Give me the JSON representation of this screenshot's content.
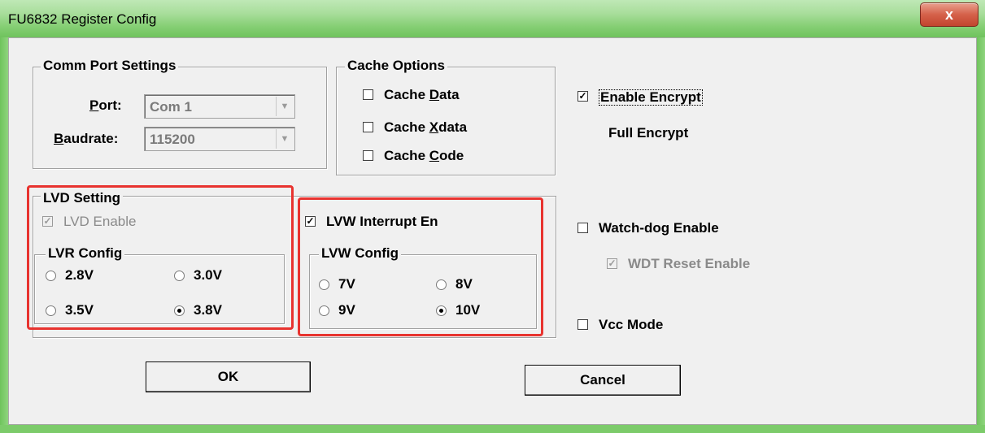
{
  "window": {
    "title": "FU6832 Register Config",
    "close_glyph": "x"
  },
  "comm_port": {
    "title": "Comm Port Settings",
    "port_label": "Port:",
    "port_value": "Com 1",
    "baud_label": "Baudrate:",
    "baud_value": "115200"
  },
  "cache": {
    "title": "Cache Options",
    "items": [
      {
        "label": "Cache Data",
        "checked": false
      },
      {
        "label": "Cache Xdata",
        "checked": false
      },
      {
        "label": "Cache Code",
        "checked": false
      }
    ]
  },
  "encrypt": {
    "enable_label": "Enable Encrypt",
    "checked": true,
    "mode_text": "Full Encrypt"
  },
  "lvd": {
    "title": "LVD Setting",
    "enable_label": "LVD Enable",
    "enable_checked": true,
    "lvr_title": "LVR Config",
    "options": [
      "2.8V",
      "3.0V",
      "3.5V",
      "3.8V"
    ],
    "selected": "3.8V"
  },
  "lvw": {
    "interrupt_label": "LVW Interrupt En",
    "interrupt_checked": true,
    "config_title": "LVW Config",
    "options": [
      "7V",
      "8V",
      "9V",
      "10V"
    ],
    "selected": "10V"
  },
  "watchdog": {
    "enable_label": "Watch-dog Enable",
    "checked": false,
    "wdt_reset_label": "WDT Reset Enable",
    "wdt_reset_checked": true
  },
  "vcc": {
    "label": "Vcc Mode",
    "checked": false
  },
  "buttons": {
    "ok": "OK",
    "cancel": "Cancel"
  },
  "colors": {
    "highlight": "#e8332f",
    "titlebar": "#86cf75"
  }
}
